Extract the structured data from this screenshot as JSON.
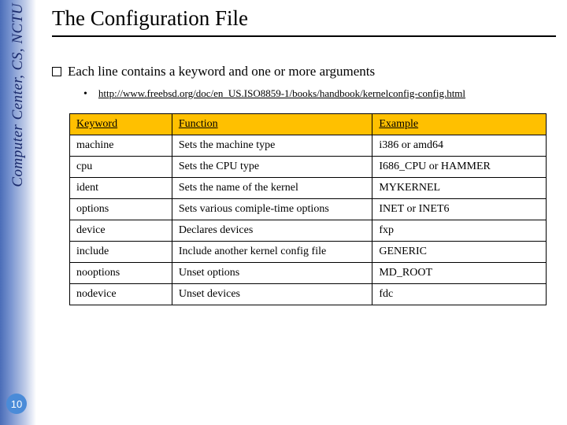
{
  "sidebar": {
    "org_text": "Computer Center, CS, NCTU",
    "page_number": "10"
  },
  "title": "The Configuration File",
  "bullet": {
    "text": "Each line contains a keyword and one or more arguments"
  },
  "sub_bullet": {
    "link_text": "http://www.freebsd.org/doc/en_US.ISO8859-1/books/handbook/kernelconfig-config.html"
  },
  "table": {
    "headers": [
      "Keyword",
      "Function",
      "Example"
    ],
    "rows": [
      {
        "c1": "machine",
        "c2": "Sets the machine type",
        "c3": "i386 or amd64"
      },
      {
        "c1": "cpu",
        "c2": "Sets the CPU type",
        "c3": "I686_CPU or HAMMER"
      },
      {
        "c1": "ident",
        "c2": "Sets the name of the kernel",
        "c3": "MYKERNEL"
      },
      {
        "c1": "options",
        "c2": "Sets various comiple-time options",
        "c3": "INET or INET6"
      },
      {
        "c1": "device",
        "c2": "Declares devices",
        "c3": "fxp"
      },
      {
        "c1": "include",
        "c2": "Include another kernel config file",
        "c3": "GENERIC"
      },
      {
        "c1": "nooptions",
        "c2": "Unset options",
        "c3": "MD_ROOT"
      },
      {
        "c1": "nodevice",
        "c2": "Unset devices",
        "c3": "fdc"
      }
    ]
  }
}
